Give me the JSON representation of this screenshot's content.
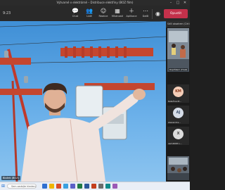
{
  "window": {
    "title": "Výtvarné v elektrárně – Distribuce elektřiny (BOZ film)",
    "minimize_icon": "minimize-icon",
    "maximize_icon": "maximize-icon",
    "close_icon": "close-icon"
  },
  "toolbar": {
    "timer": "9:23",
    "buttons": [
      {
        "label": "Chat",
        "icon": "chat-icon"
      },
      {
        "label": "Lidé",
        "icon": "people-icon"
      },
      {
        "label": "Reakce",
        "icon": "reactions-icon"
      },
      {
        "label": "Místnosti",
        "icon": "rooms-icon"
      },
      {
        "label": "Aplikace",
        "icon": "apps-icon"
      },
      {
        "label": "Další",
        "icon": "more-icon"
      }
    ],
    "camera_icon": "camera-icon",
    "leave_label": "Opustit"
  },
  "stage": {
    "presenter_label": "Blažek (BOZ)"
  },
  "sidebar": {
    "header": "Sdílí obsahem (Cirt in...",
    "featured_name": "Doplňkem (Host)",
    "participants": [
      {
        "initials": "KM",
        "name": "Kateřina M...",
        "color": "#f4cdb8",
        "text_color": "#8a3a1e"
      },
      {
        "initials": "AJ",
        "name": "Alexandra...",
        "color": "#d6dde8",
        "text_color": "#3a4e6b"
      },
      {
        "initials": "X",
        "name": "xem4008 L...",
        "color": "#dcdcdc",
        "text_color": "#444444"
      }
    ]
  },
  "taskbar": {
    "search_placeholder": "Sem zadejte hledaný výraz"
  }
}
